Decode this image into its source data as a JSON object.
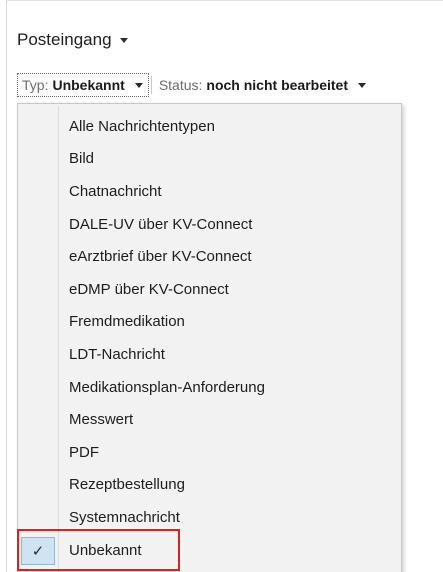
{
  "header": {
    "title": "Posteingang"
  },
  "filters": {
    "typ_label": "Typ:",
    "typ_value": "Unbekannt",
    "status_label": "Status:",
    "status_value": "noch nicht bearbeitet"
  },
  "dropdown": {
    "items": [
      {
        "label": "Alle Nachrichtentypen",
        "selected": false
      },
      {
        "label": "Bild",
        "selected": false
      },
      {
        "label": "Chatnachricht",
        "selected": false
      },
      {
        "label": "DALE-UV über KV-Connect",
        "selected": false
      },
      {
        "label": "eArztbrief über KV-Connect",
        "selected": false
      },
      {
        "label": "eDMP über KV-Connect",
        "selected": false
      },
      {
        "label": "Fremdmedikation",
        "selected": false
      },
      {
        "label": "LDT-Nachricht",
        "selected": false
      },
      {
        "label": "Medikationsplan-Anforderung",
        "selected": false
      },
      {
        "label": "Messwert",
        "selected": false
      },
      {
        "label": "PDF",
        "selected": false
      },
      {
        "label": "Rezeptbestellung",
        "selected": false
      },
      {
        "label": "Systemnachricht",
        "selected": false
      },
      {
        "label": "Unbekannt",
        "selected": true
      }
    ],
    "check_glyph": "✓"
  },
  "colors": {
    "highlight_border": "#e0201c",
    "selected_bg": "#cfe3f3",
    "menu_bg": "#f2f2f2"
  }
}
